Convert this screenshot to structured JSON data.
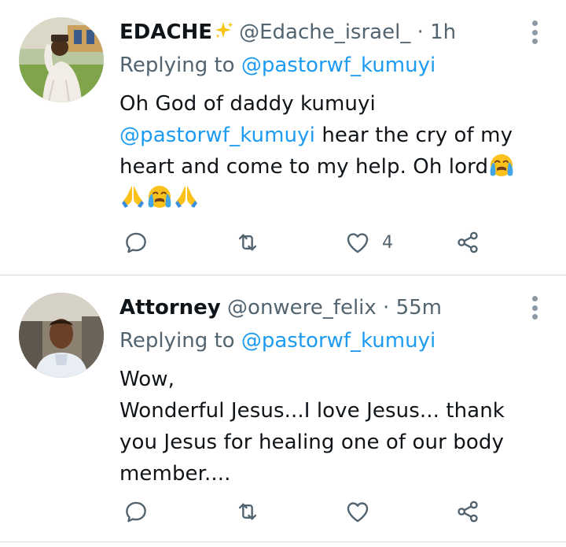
{
  "colors": {
    "accent": "#1d9bf0",
    "muted": "#536471",
    "text": "#0f1419"
  },
  "tweets": [
    {
      "name": "EDACHE",
      "handle": "@Edache_israel_",
      "sep": "·",
      "time": "1h",
      "replying_label": "Replying to",
      "replying_to": "@pastorwf_kumuyi",
      "line1": "Oh God of daddy kumuyi",
      "line2_mention": "@pastorwf_kumuyi",
      "line2_rest": " hear the cry of my",
      "line3": "heart and come to my help. Oh lord",
      "like_count": "4",
      "icons": [
        "sparkles-icon",
        "crying-face-icon",
        "folded-hands-icon"
      ]
    },
    {
      "name": "Attorney",
      "handle": "@onwere_felix",
      "sep": "·",
      "time": "55m",
      "replying_label": "Replying to",
      "replying_to": "@pastorwf_kumuyi",
      "line1": "Wow,",
      "line2": "Wonderful Jesus...I love Jesus... thank",
      "line3": "you Jesus for healing one of our body",
      "line4": "member....",
      "like_count": ""
    }
  ]
}
